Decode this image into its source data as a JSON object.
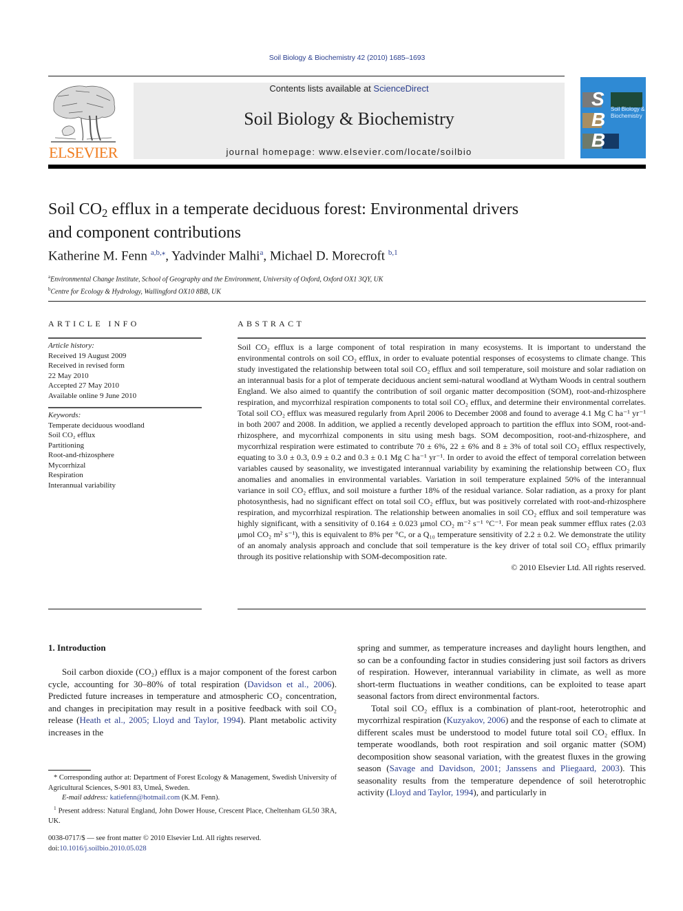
{
  "header": {
    "citation": "Soil Biology & Biochemistry 42 (2010) 1685–1693",
    "contents_prefix": "Contents lists available at ",
    "contents_link": "ScienceDirect",
    "journal_title": "Soil Biology & Biochemistry",
    "homepage_prefix": "journal homepage: ",
    "homepage_url": "www.elsevier.com/locate/soilbio",
    "publisher_logo_text": "ELSEVIER",
    "cover": {
      "letters": [
        "S",
        "B",
        "B"
      ],
      "title_line1": "Soil Biology &",
      "title_line2": "Biochemistry"
    }
  },
  "article": {
    "title_part1": "Soil CO",
    "title_sub": "2",
    "title_part2": " efflux in a temperate deciduous forest: Environmental drivers",
    "title_line2": "and component contributions",
    "authors": [
      {
        "name": "Katherine M. Fenn",
        "marks": "a,b,⁎"
      },
      {
        "name": "Yadvinder Malhi",
        "marks": "a"
      },
      {
        "name": "Michael D. Morecroft",
        "marks": "b,1"
      }
    ],
    "affiliations": [
      {
        "mark": "a",
        "text": "Environmental Change Institute, School of Geography and the Environment, University of Oxford, Oxford OX1 3QY, UK"
      },
      {
        "mark": "b",
        "text": "Centre for Ecology & Hydrology, Wallingford OX10 8BB, UK"
      }
    ]
  },
  "article_info": {
    "heading": "ARTICLE INFO",
    "history_label": "Article history:",
    "history": [
      "Received 19 August 2009",
      "Received in revised form",
      "22 May 2010",
      "Accepted 27 May 2010",
      "Available online 9 June 2010"
    ],
    "keywords_label": "Keywords:",
    "keywords": [
      "Temperate deciduous woodland",
      "Soil CO₂ efflux",
      "Partitioning",
      "Root-and-rhizosphere",
      "Mycorrhizal",
      "Respiration",
      "Interannual variability"
    ]
  },
  "abstract": {
    "heading": "ABSTRACT",
    "text": "Soil CO₂ efflux is a large component of total respiration in many ecosystems. It is important to understand the environmental controls on soil CO₂ efflux, in order to evaluate potential responses of ecosystems to climate change. This study investigated the relationship between total soil CO₂ efflux and soil temperature, soil moisture and solar radiation on an interannual basis for a plot of temperate deciduous ancient semi-natural woodland at Wytham Woods in central southern England. We also aimed to quantify the contribution of soil organic matter decomposition (SOM), root-and-rhizosphere respiration, and mycorrhizal respiration components to total soil CO₂ efflux, and determine their environmental correlates. Total soil CO₂ efflux was measured regularly from April 2006 to December 2008 and found to average 4.1 Mg C ha⁻¹ yr⁻¹ in both 2007 and 2008. In addition, we applied a recently developed approach to partition the efflux into SOM, root-and-rhizosphere, and mycorrhizal components in situ using mesh bags. SOM decomposition, root-and-rhizosphere, and mycorrhizal respiration were estimated to contribute 70 ± 6%, 22 ± 6% and 8 ± 3% of total soil CO₂ efflux respectively, equating to 3.0 ± 0.3, 0.9 ± 0.2 and 0.3 ± 0.1 Mg C ha⁻¹ yr⁻¹. In order to avoid the effect of temporal correlation between variables caused by seasonality, we investigated interannual variability by examining the relationship between CO₂ flux anomalies and anomalies in environmental variables. Variation in soil temperature explained 50% of the interannual variance in soil CO₂ efflux, and soil moisture a further 18% of the residual variance. Solar radiation, as a proxy for plant photosynthesis, had no significant effect on total soil CO₂ efflux, but was positively correlated with root-and-rhizosphere respiration, and mycorrhizal respiration. The relationship between anomalies in soil CO₂ efflux and soil temperature was highly significant, with a sensitivity of 0.164 ± 0.023 μmol CO₂ m⁻² s⁻¹ °C⁻¹. For mean peak summer efflux rates (2.03 μmol CO₂ m² s⁻¹), this is equivalent to 8% per °C, or a Q₁₀ temperature sensitivity of 2.2 ± 0.2. We demonstrate the utility of an anomaly analysis approach and conclude that soil temperature is the key driver of total soil CO₂ efflux primarily through its positive relationship with SOM-decomposition rate.",
    "copyright": "© 2010 Elsevier Ltd. All rights reserved."
  },
  "introduction": {
    "heading": "1.  Introduction",
    "left": {
      "p1_a": "Soil carbon dioxide (CO₂) efflux is a major component of the forest carbon cycle, accounting for 30–80% of total respiration (",
      "p1_ref1": "Davidson et al., 2006",
      "p1_b": "). Predicted future increases in temperature and atmospheric CO₂ concentration, and changes in precipitation may result in a positive feedback with soil CO₂ release (",
      "p1_ref2": "Heath et al., 2005; Lloyd and Taylor, 1994",
      "p1_c": "). Plant metabolic activity increases in the"
    },
    "right": {
      "p1": "spring and summer, as temperature increases and daylight hours lengthen, and so can be a confounding factor in studies considering just soil factors as drivers of respiration. However, interannual variability in climate, as well as more short-term fluctuations in weather conditions, can be exploited to tease apart seasonal factors from direct environmental factors.",
      "p2_a": "Total soil CO₂ efflux is a combination of plant-root, heterotrophic and mycorrhizal respiration (",
      "p2_ref1": "Kuzyakov, 2006",
      "p2_b": ") and the response of each to climate at different scales must be understood to model future total soil CO₂ efflux. In temperate woodlands, both root respiration and soil organic matter (SOM) decomposition show seasonal variation, with the greatest fluxes in the growing season (",
      "p2_ref2": "Savage and Davidson, 2001; Janssens and Pliegaard, 2003",
      "p2_c": "). This seasonality results from the temperature dependence of soil heterotrophic activity (",
      "p2_ref3": "Lloyd and Taylor, 1994",
      "p2_d": "), and particularly in"
    }
  },
  "footnotes": {
    "corresponding": "* Corresponding author at: Department of Forest Ecology & Management, Swedish University of Agricultural Sciences, S-901 83, Umeå, Sweden.",
    "email_label": "E-mail address: ",
    "email": "katiefenn@hotmail.com",
    "email_suffix": " (K.M. Fenn).",
    "present_mark": "1",
    "present": " Present address: Natural England, John Dower House, Crescent Place, Cheltenham GL50 3RA, UK.",
    "issn": "0038-0717/$ — see front matter © 2010 Elsevier Ltd. All rights reserved.",
    "doi_label": "doi:",
    "doi": "10.1016/j.soilbio.2010.05.028"
  },
  "colors": {
    "link": "#2b3f8f",
    "elsevier_orange": "#f07c1e",
    "cover_blue": "#2f8ad4",
    "masthead_bg": "#ececec"
  }
}
